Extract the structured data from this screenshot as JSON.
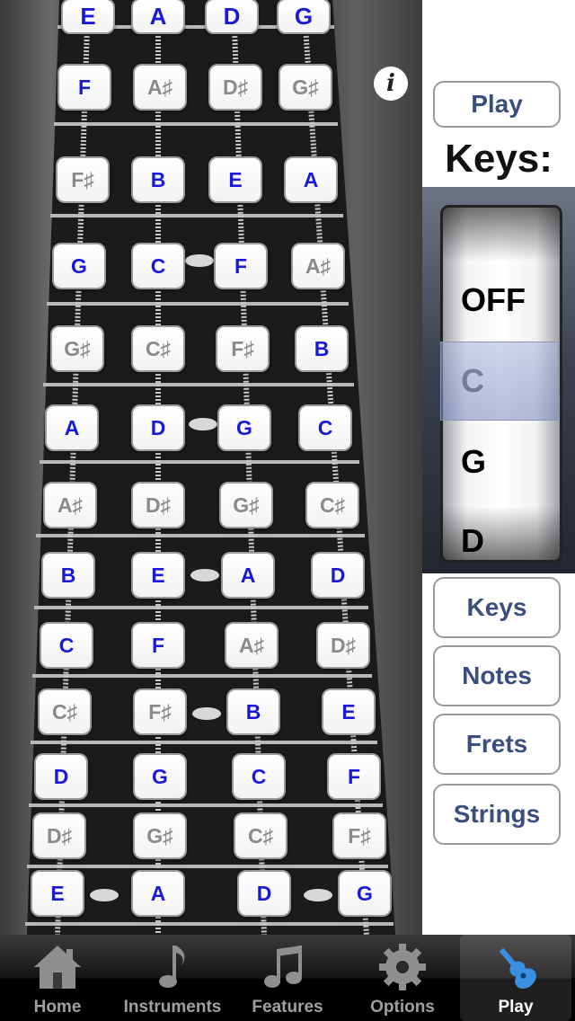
{
  "fretboard": {
    "open_strings": [
      "E",
      "A",
      "D",
      "G"
    ],
    "frets": [
      [
        "F",
        "A♯",
        "D♯",
        "G♯"
      ],
      [
        "F♯",
        "B",
        "E",
        "A"
      ],
      [
        "G",
        "C",
        "F",
        "A♯"
      ],
      [
        "G♯",
        "C♯",
        "F♯",
        "B"
      ],
      [
        "A",
        "D",
        "G",
        "C"
      ],
      [
        "A♯",
        "D♯",
        "G♯",
        "C♯"
      ],
      [
        "B",
        "E",
        "A",
        "D"
      ],
      [
        "C",
        "F",
        "A♯",
        "D♯"
      ],
      [
        "C♯",
        "F♯",
        "B",
        "E"
      ],
      [
        "D",
        "G",
        "C",
        "F"
      ],
      [
        "D♯",
        "G♯",
        "C♯",
        "F♯"
      ],
      [
        "E",
        "A",
        "D",
        "G"
      ]
    ],
    "info_label": "i"
  },
  "side": {
    "play_label": "Play",
    "keys_title": "Keys:",
    "picker": {
      "options": [
        "OFF",
        "C",
        "G",
        "D"
      ],
      "selected": "C"
    },
    "buttons": [
      "Keys",
      "Notes",
      "Frets",
      "Strings"
    ]
  },
  "tabbar": {
    "tabs": [
      {
        "label": "Home",
        "icon": "home-icon"
      },
      {
        "label": "Instruments",
        "icon": "note-icon"
      },
      {
        "label": "Features",
        "icon": "music-notes-icon"
      },
      {
        "label": "Options",
        "icon": "gear-icon"
      },
      {
        "label": "Play",
        "icon": "guitar-icon"
      }
    ],
    "active": "Play"
  },
  "colors": {
    "natural_note": "#1a1ad6",
    "sharp_note": "#8a8a8a",
    "button_text": "#3a4f7d",
    "active_tab_icon": "#3b8fe0"
  }
}
